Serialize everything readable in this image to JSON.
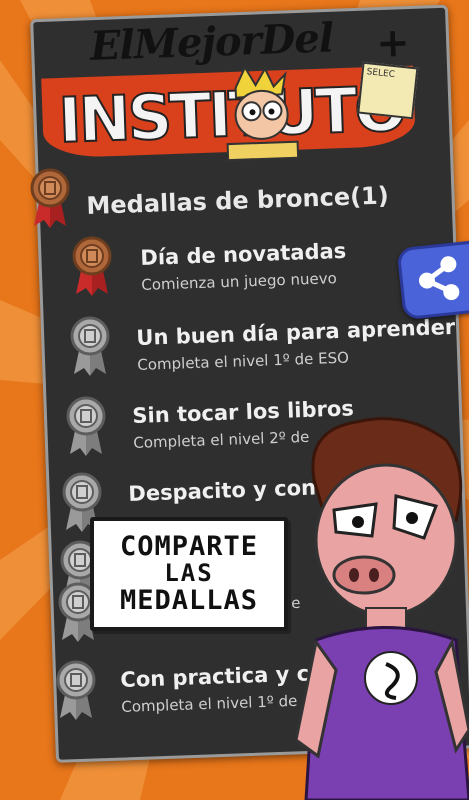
{
  "logo": {
    "script_text": "ElMejorDel",
    "plus": "+",
    "main_text": "INSTITUTO",
    "sign_text": "SELEC"
  },
  "section": {
    "title": "Medallas de bronce(1)",
    "medal_type": "bronze"
  },
  "achievements": [
    {
      "title": "Día de novatadas",
      "description": "Comienza un juego nuevo",
      "medal": "bronze"
    },
    {
      "title": "Un buen día para aprender",
      "description": "Completa el nivel 1º de ESO",
      "medal": "silver"
    },
    {
      "title": "Sin tocar los libros",
      "description": "Completa el nivel 2º de",
      "medal": "silver"
    },
    {
      "title": "Despacito y con",
      "description": "",
      "medal": "silver"
    },
    {
      "title": "",
      "description": "",
      "medal": "silver"
    },
    {
      "title": "",
      "description": "Completa el nivel 4º de",
      "medal": "silver"
    },
    {
      "title": "Con practica y c",
      "description": "Completa el nivel 1º de",
      "medal": "silver"
    }
  ],
  "share_button": {
    "icon": "share-icon"
  },
  "callout": {
    "line1": "COMPARTE",
    "line2": "LAS",
    "line3": "MEDALLAS"
  },
  "colors": {
    "background": "#e8761a",
    "panel": "#2f2f30",
    "share_button": "#4a63d9",
    "bronze": "#b0673a",
    "silver": "#a9a9a9",
    "ribbon_red": "#c92b2b"
  }
}
